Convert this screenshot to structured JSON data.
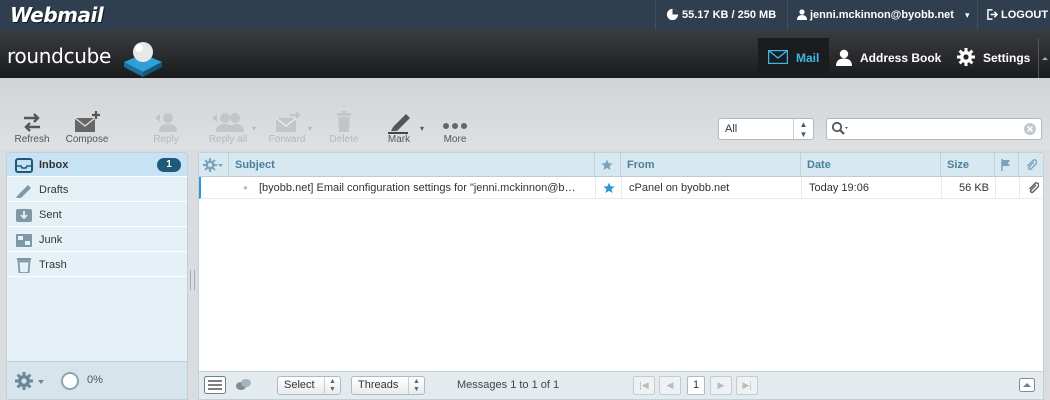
{
  "topbar": {
    "brand": "Webmail",
    "quota": "55.17 KB / 250 MB",
    "user": "jenni.mckinnon@byobb.net",
    "user_caret": "▾",
    "logout": "LOGOUT"
  },
  "header": {
    "logo": "roundcube",
    "nav": [
      {
        "label": "Mail",
        "icon": "envelope-icon",
        "active": true
      },
      {
        "label": "Address Book",
        "icon": "person-icon",
        "active": false
      },
      {
        "label": "Settings",
        "icon": "gear-icon",
        "active": false
      }
    ]
  },
  "toolbar": {
    "refresh": "Refresh",
    "compose": "Compose",
    "reply": "Reply",
    "reply_all": "Reply all",
    "forward": "Forward",
    "delete": "Delete",
    "mark": "Mark",
    "more": "More",
    "filter_value": "All",
    "search_placeholder": ""
  },
  "folders": [
    {
      "name": "Inbox",
      "unread": "1",
      "icon": "inbox-icon",
      "selected": true
    },
    {
      "name": "Drafts",
      "icon": "pencil-icon"
    },
    {
      "name": "Sent",
      "icon": "sent-icon"
    },
    {
      "name": "Junk",
      "icon": "junk-icon"
    },
    {
      "name": "Trash",
      "icon": "trash-icon"
    }
  ],
  "folder_footer": {
    "quota_percent": "0%"
  },
  "message_list": {
    "columns": {
      "subject": "Subject",
      "from": "From",
      "date": "Date",
      "size": "Size"
    },
    "rows": [
      {
        "subject": "[byobb.net] Email configuration settings for \"jenni.mckinnon@b…",
        "flagged": true,
        "from": "cPanel on byobb.net",
        "date": "Today 19:06",
        "size": "56 KB",
        "attachment": true
      }
    ]
  },
  "list_footer": {
    "select_label": "Select",
    "threads_label": "Threads",
    "count_text": "Messages 1 to 1 of 1",
    "page": "1"
  },
  "colors": {
    "accent": "#3fb8e8",
    "topbar": "#2f3f4f",
    "badge": "#1e5a7a"
  }
}
